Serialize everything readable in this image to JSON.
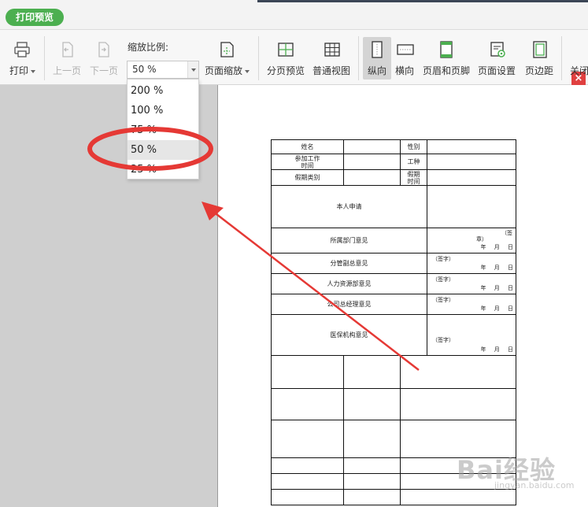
{
  "header": {
    "tag_button": "打印预览"
  },
  "toolbar": {
    "print": "打印",
    "prev_page": "上一页",
    "next_page": "下一页",
    "zoom_label": "缩放比例:",
    "zoom_value": "50 %",
    "page_zoom": "页面缩放",
    "page_break_preview": "分页预览",
    "normal_view": "普通视图",
    "portrait": "纵向",
    "landscape": "横向",
    "header_footer": "页眉和页脚",
    "page_setup": "页面设置",
    "margins": "页边距",
    "close": "关闭"
  },
  "zoom_dropdown": {
    "options": [
      "200 %",
      "100 %",
      "75 %",
      "50 %",
      "25 %"
    ],
    "selected": "50 %"
  },
  "form": {
    "name": "姓名",
    "gender": "性别",
    "join_work_time_1": "参加工作",
    "join_work_time_2": "时间",
    "job_type": "工种",
    "leave_type": "假期类别",
    "leave_period_1": "假期",
    "leave_period_2": "时间",
    "personal_application": "本人申请",
    "dept_opinion": "所属部门意见",
    "signature_seal_1": "（签",
    "signature_seal_2": "章）",
    "vp_opinion": "分管副总意见",
    "hr_opinion": "人力资源部意见",
    "gm_opinion": "公司总经理意见",
    "medical_opinion": "医保机构意见",
    "signature": "（签字）",
    "date": "年 月 日"
  },
  "colors": {
    "accent_green": "#4caf50",
    "annotation_red": "#e53935"
  },
  "watermark": {
    "text": "Bai经验",
    "url": "jingyan.baidu.com"
  }
}
